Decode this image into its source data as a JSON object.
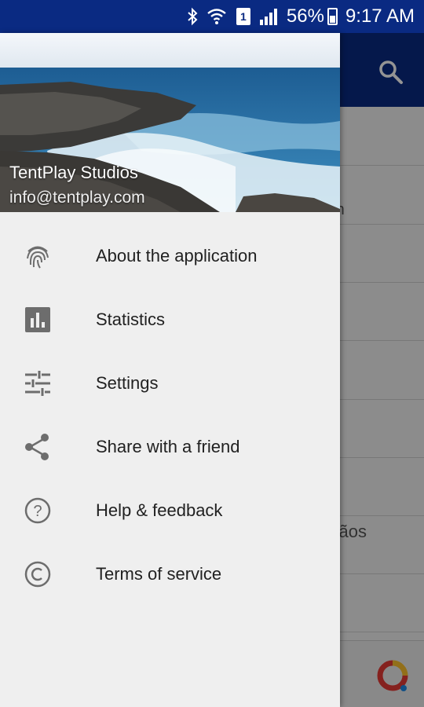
{
  "status_bar": {
    "battery_percent": "56%",
    "time": "9:17 AM",
    "sim": "1",
    "icons": [
      "bluetooth-icon",
      "wifi-icon",
      "sim-icon",
      "signal-icon",
      "battery-icon"
    ]
  },
  "background_app": {
    "list_fragments": [
      "ion",
      "rgãos"
    ],
    "colors": {
      "toolbar": "#0a2a82"
    }
  },
  "drawer": {
    "header": {
      "name": "TentPlay Studios",
      "email": "info@tentplay.com"
    },
    "items": [
      {
        "label": "About the application",
        "icon": "fingerprint-icon"
      },
      {
        "label": "Statistics",
        "icon": "bar-chart-icon"
      },
      {
        "label": "Settings",
        "icon": "sliders-icon"
      },
      {
        "label": "Share with a friend",
        "icon": "share-icon"
      },
      {
        "label": "Help & feedback",
        "icon": "help-icon"
      },
      {
        "label": "Terms of service",
        "icon": "copyright-icon"
      }
    ]
  }
}
